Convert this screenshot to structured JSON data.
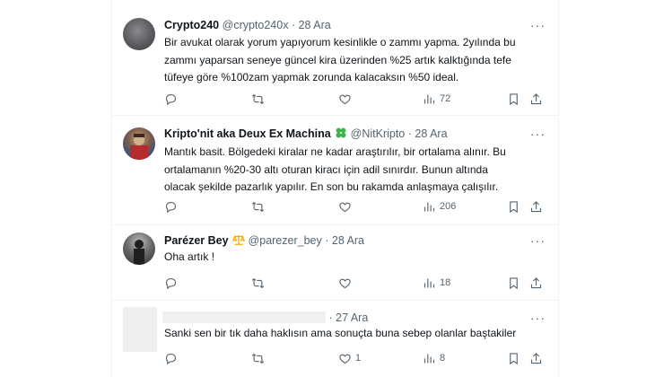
{
  "tweets": [
    {
      "name": "Crypto240",
      "handle": "@crypto240x",
      "dot": "·",
      "date": "28 Ara",
      "text_lines": [
        "Bir avukat olarak yorum yapıyorum kesinlikle o zammı yapma. 2yılında bu",
        "zammı yaparsan seneye güncel kira üzerinden %25 artık kalktığında tefe",
        "tüfeye göre %100zam yapmak zorunda kalacaksın %50 ideal."
      ],
      "views": "72"
    },
    {
      "name": "Kripto'nit aka Deux Ex Machina",
      "emoji": "✤",
      "handle": "@NitKripto",
      "dot": "·",
      "date": "28 Ara",
      "text_lines": [
        "Mantık basit. Bölgedeki kiralar ne kadar araştırılır, bir ortalama alınır. Bu",
        "ortalamanın %20-30 altı oturan kiracı için adil sınırdır. Bunun altında",
        "olacak şekilde pazarlık yapılır. En son bu rakamda anlaşmaya çalışılır."
      ],
      "views": "206"
    },
    {
      "name": "Parézer Bey",
      "emoji": "⚖",
      "handle": "@parezer_bey",
      "dot": "·",
      "date": "28 Ara",
      "text_lines": [
        "Oha artık !"
      ],
      "views": "18"
    },
    {
      "dot": "·",
      "date": "27 Ara",
      "text_lines": [
        "Sanki sen bir tık daha haklısın  ama sonuçta buna sebep olanlar baştakiler"
      ],
      "likes": "1",
      "views": "8"
    }
  ],
  "colors": {
    "text": "#0f1419",
    "secondary": "#536471",
    "border": "#eff3f4",
    "clover": "#3fb44a",
    "scales": "#f2a900"
  },
  "icons": [
    "reply-icon",
    "retweet-icon",
    "like-icon",
    "views-icon",
    "bookmark-icon",
    "share-icon",
    "more-icon"
  ]
}
